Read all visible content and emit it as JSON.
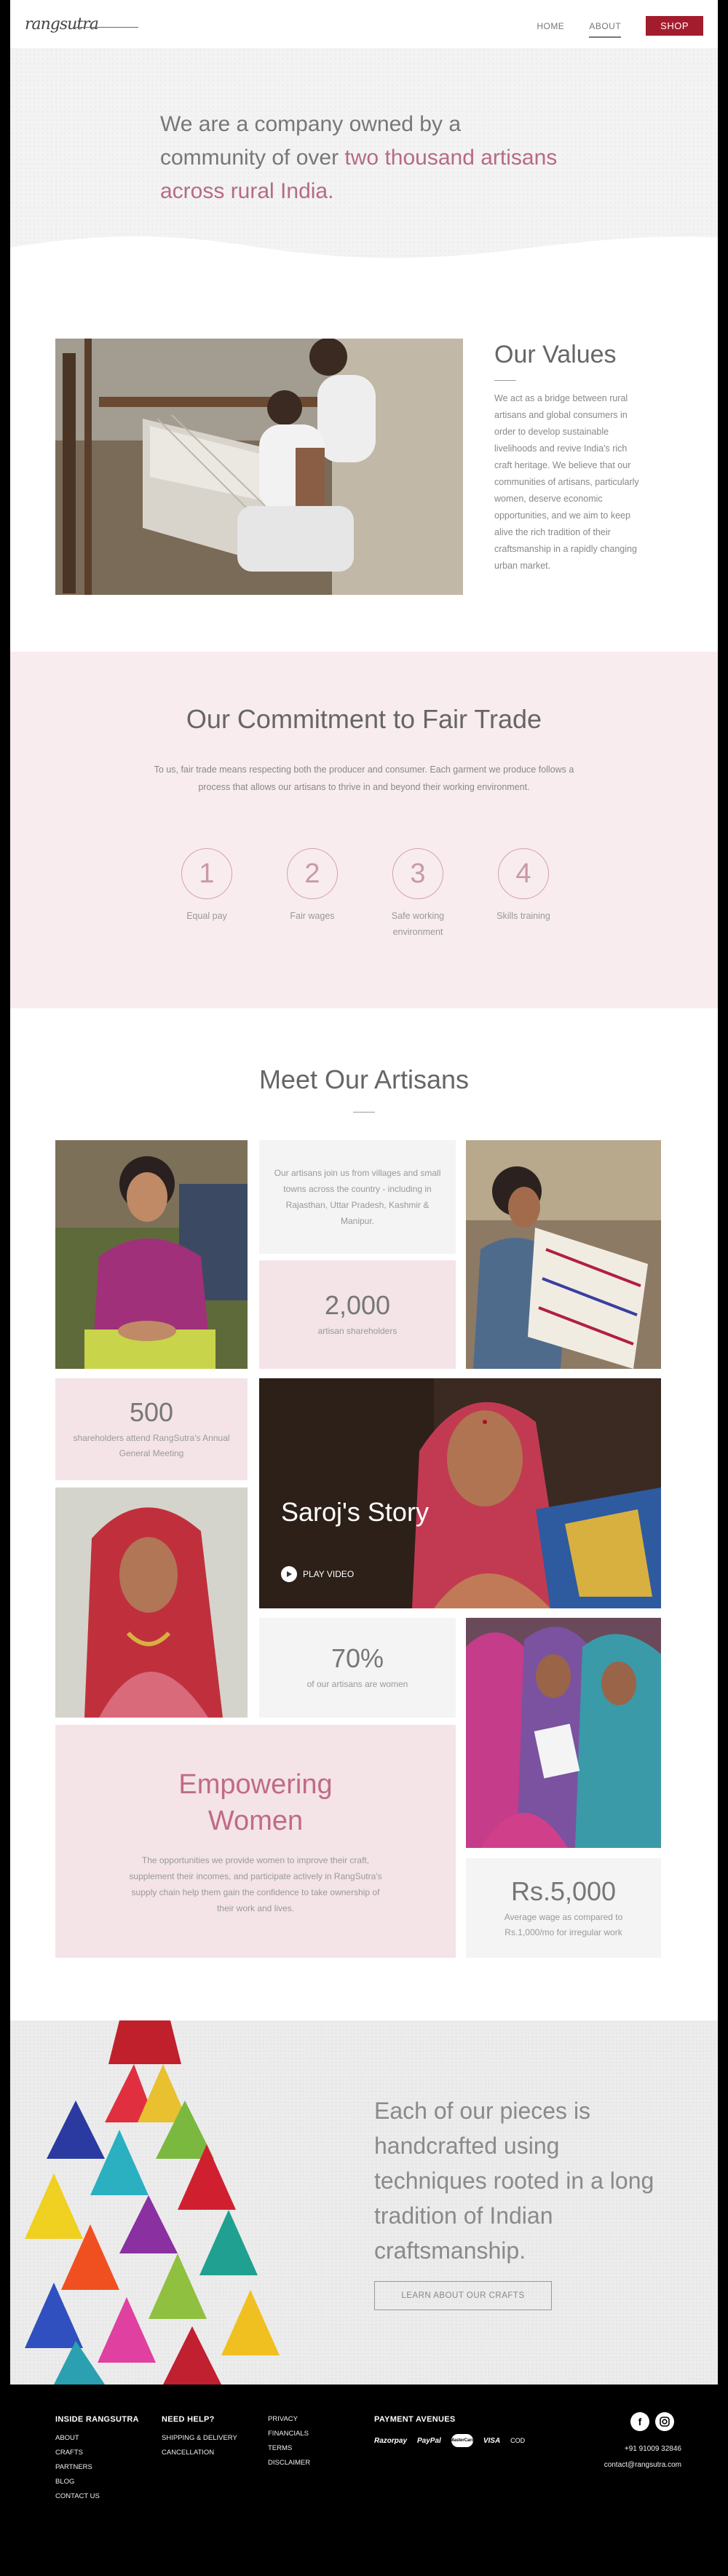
{
  "header": {
    "logo": "rangsutra",
    "nav": [
      {
        "label": "HOME"
      },
      {
        "label": "ABOUT"
      }
    ],
    "shop_label": "SHOP"
  },
  "hero": {
    "text_plain": "We are a company owned by a community of over ",
    "text_accent": "two thousand artisans across rural India."
  },
  "values": {
    "title": "Our Values",
    "body": "We act as a bridge between rural artisans and global consumers in order to develop sustainable livelihoods and revive India's rich craft heritage. We believe that our communities of artisans, particularly women, deserve economic opportunities, and we aim to keep alive the rich tradition of their craftsmanship in a rapidly changing urban market."
  },
  "fair_trade": {
    "title": "Our Commitment to Fair Trade",
    "description": "To us, fair trade means respecting both the producer and consumer. Each garment we produce follows a process that allows our artisans to thrive in and beyond their working environment.",
    "items": [
      {
        "num": "1",
        "label": "Equal pay"
      },
      {
        "num": "2",
        "label": "Fair wages"
      },
      {
        "num": "3",
        "label": "Safe working environment"
      },
      {
        "num": "4",
        "label": "Skills training"
      }
    ]
  },
  "artisans": {
    "title": "Meet Our Artisans",
    "villages_text": "Our artisans join us from villages and small towns across the country - including in Rajasthan, Uttar Pradesh, Kashmir & Manipur.",
    "stat1": {
      "value": "2,000",
      "label": "artisan shareholders"
    },
    "stat2": {
      "value": "500",
      "label": "shareholders attend RangSutra's Annual General Meeting"
    },
    "story": {
      "title": "Saroj's Story",
      "play_label": "PLAY VIDEO"
    },
    "stat3": {
      "value": "70%",
      "label": "of our artisans are women"
    },
    "empower": {
      "title": "Empowering Women",
      "body": "The opportunities we provide women to improve their craft, supplement their incomes, and participate actively in RangSutra's supply chain help them gain the confidence to take ownership of their work and lives."
    },
    "stat4": {
      "value": "Rs.5,000",
      "label": "Average wage as compared to Rs.1,000/mo for irregular work"
    }
  },
  "craft": {
    "headline": "Each of our pieces is handcrafted using techniques rooted in a long tradition of Indian craftsmanship.",
    "button": "LEARN ABOUT OUR CRAFTS"
  },
  "footer": {
    "col1": {
      "title": "INSIDE RANGSUTRA",
      "links": [
        "ABOUT",
        "CRAFTS",
        "PARTNERS",
        "BLOG",
        "CONTACT US"
      ]
    },
    "col2": {
      "title": "NEED HELP?",
      "links": [
        "SHIPPING & DELIVERY",
        "CANCELLATION"
      ]
    },
    "col3": {
      "links": [
        "PRIVACY",
        "FINANCIALS",
        "TERMS",
        "DISCLAIMER"
      ]
    },
    "payment": {
      "title": "PAYMENT AVENUES",
      "methods": [
        "Razorpay",
        "PayPal",
        "MasterCard",
        "VISA",
        "COD"
      ]
    },
    "phone": "+91 91009 32846",
    "email": "contact@rangsutra.com"
  },
  "colors": {
    "accent": "#a31c2e",
    "pink_bg": "#f8ecee",
    "rose_text": "#c06b86"
  }
}
